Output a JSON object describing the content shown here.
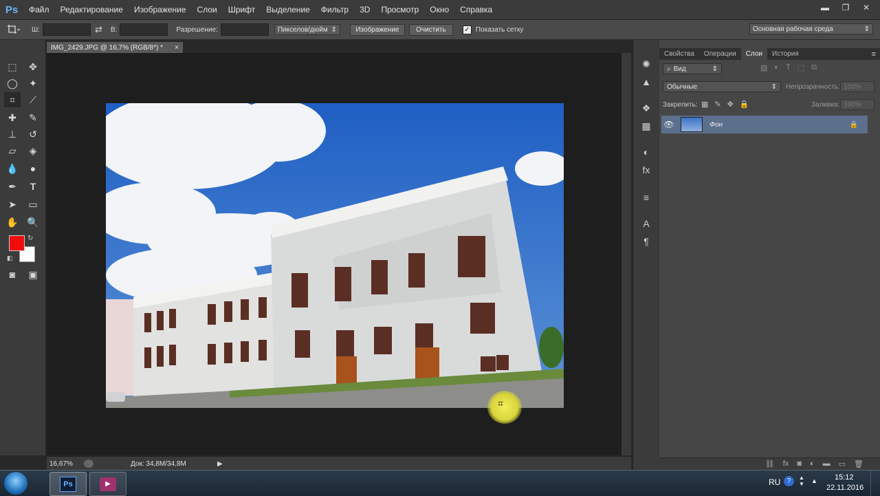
{
  "app": {
    "logo": "Ps"
  },
  "menu": [
    "Файл",
    "Редактирование",
    "Изображение",
    "Слои",
    "Шрифт",
    "Выделение",
    "Фильтр",
    "3D",
    "Просмотр",
    "Окно",
    "Справка"
  ],
  "window_controls": {
    "minimize": "▬",
    "restore": "❐",
    "close": "✕"
  },
  "options": {
    "width_label": "Ш:",
    "swap_icon": "⇄",
    "height_label": "В:",
    "resolution_label": "Разрешение:",
    "units": "Пикселов/дюйм",
    "image_button": "Изображение",
    "clear_button": "Очистить",
    "grid_checkbox_label": "Показать сетку",
    "workspace": "Основная рабочая среда"
  },
  "document": {
    "tab_title": "IMG_2429.JPG @ 16,7% (RGB/8*) *",
    "close": "×",
    "zoom": "16,67%",
    "doc_info": "Док: 34,8M/34,8M"
  },
  "colors": {
    "foreground": "#f20d0d",
    "background": "#ffffff",
    "accent": "#5c6f8c"
  },
  "panel": {
    "tabs": [
      "Свойства",
      "Операции",
      "Слои",
      "История"
    ],
    "active_tab": "Слои",
    "filter_kind": "Вид",
    "blend_mode": "Обычные",
    "opacity_label": "Непрозрачность:",
    "opacity_value": "100%",
    "lock_label": "Закрепить:",
    "fill_label": "Заливка:",
    "fill_value": "100%",
    "layers": [
      {
        "name": "Фон",
        "visible": true,
        "locked": true
      }
    ]
  },
  "taskbar": {
    "language": "RU",
    "time": "15:12",
    "date": "22.11.2016"
  }
}
